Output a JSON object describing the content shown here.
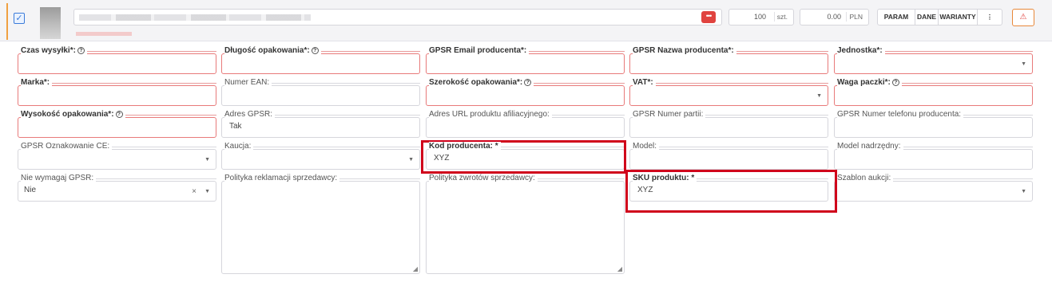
{
  "product_row": {
    "quantity": "100",
    "quantity_unit": "szt.",
    "price": "0.00",
    "currency": "PLN",
    "actions": [
      "PARAM",
      "DANE",
      "WARIANTY"
    ],
    "more_icon": "vertical-dots-icon",
    "warning_icon": "warning-triangle-icon"
  },
  "fields": {
    "czas_wysylki": {
      "label": "Czas wysyłki*:"
    },
    "dlugosc_opakowania": {
      "label": "Długość opakowania*:"
    },
    "gpsr_email": {
      "label": "GPSR Email producenta*:"
    },
    "gpsr_nazwa": {
      "label": "GPSR Nazwa producenta*:"
    },
    "jednostka": {
      "label": "Jednostka*:"
    },
    "marka": {
      "label": "Marka*:"
    },
    "numer_ean": {
      "label": "Numer EAN:"
    },
    "szerokosc_opakowania": {
      "label": "Szerokość opakowania*:"
    },
    "vat": {
      "label": "VAT*:"
    },
    "waga_paczki": {
      "label": "Waga paczki*:"
    },
    "wysokosc_opakowania": {
      "label": "Wysokość opakowania*:"
    },
    "adres_gpsr": {
      "label": "Adres GPSR:",
      "value": "Tak"
    },
    "adres_url": {
      "label": "Adres URL produktu afiliacyjnego:"
    },
    "gpsr_numer_partii": {
      "label": "GPSR Numer partii:"
    },
    "gpsr_telefon": {
      "label": "GPSR Numer telefonu producenta:"
    },
    "gpsr_ce": {
      "label": "GPSR Oznakowanie CE:"
    },
    "kaucja": {
      "label": "Kaucja:"
    },
    "kod_producenta": {
      "label": "Kod producenta: *",
      "value": "XYZ"
    },
    "model": {
      "label": "Model:"
    },
    "model_nadrzedny": {
      "label": "Model nadrzędny:"
    },
    "nie_wymagaj_gpsr": {
      "label": "Nie wymagaj GPSR:",
      "value": "Nie"
    },
    "polityka_reklamacji": {
      "label": "Polityka reklamacji sprzedawcy:"
    },
    "polityka_zwrotow": {
      "label": "Polityka zwrotów sprzedawcy:"
    },
    "sku_produktu": {
      "label": "SKU produktu: *",
      "value": "XYZ"
    },
    "szablon_aukcji": {
      "label": "Szablon aukcji:"
    }
  },
  "colors": {
    "required_border": "#e87a7a",
    "highlight": "#d0021b",
    "accent": "#f0a040",
    "checkbox": "#3b7bd9"
  }
}
